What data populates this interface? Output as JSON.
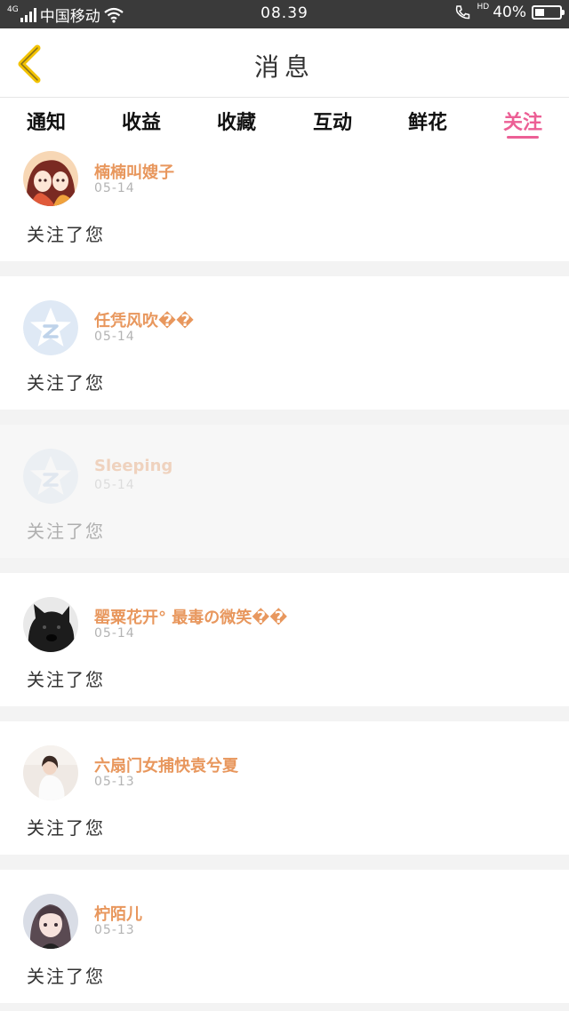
{
  "status_bar": {
    "network": "4G",
    "carrier": "中国移动",
    "time": "08.39",
    "call_tag": "HD",
    "battery": "40%",
    "battery_level": 0.4,
    "icons": [
      "signal-icon",
      "wifi-icon",
      "call-icon",
      "battery-icon"
    ]
  },
  "header": {
    "title": "消息",
    "back_icon": "chevron-left-icon",
    "accent": "#f2c200"
  },
  "tabs": [
    "通知",
    "收益",
    "收藏",
    "互动",
    "鲜花",
    "关注"
  ],
  "active_tab": 5,
  "colors": {
    "accent_pink": "#ec5f95",
    "username": "#e8975d",
    "date": "#b3b3b3",
    "divider": "#f3f3f3"
  },
  "messages": [
    {
      "name": "楠楠叫嫂子",
      "date": "05-14",
      "text": "关注了您",
      "avatar": "anime-girl-avatar"
    },
    {
      "name": "任凭风吹��",
      "date": "05-14",
      "text": "关注了您",
      "avatar": "default-star-avatar"
    },
    {
      "name": "Sleeping",
      "date": "05-14",
      "text": "关注了您",
      "avatar": "default-star-avatar"
    },
    {
      "name": "罂粟花开° 最毒の微笑��",
      "date": "05-14",
      "text": "关注了您",
      "avatar": "black-dog-avatar"
    },
    {
      "name": "六扇门女捕快袁兮夏",
      "date": "05-13",
      "text": "关注了您",
      "avatar": "girl-photo-avatar"
    },
    {
      "name": "柠陌儿",
      "date": "05-13",
      "text": "关注了您",
      "avatar": "anime-girl-2-avatar"
    }
  ]
}
